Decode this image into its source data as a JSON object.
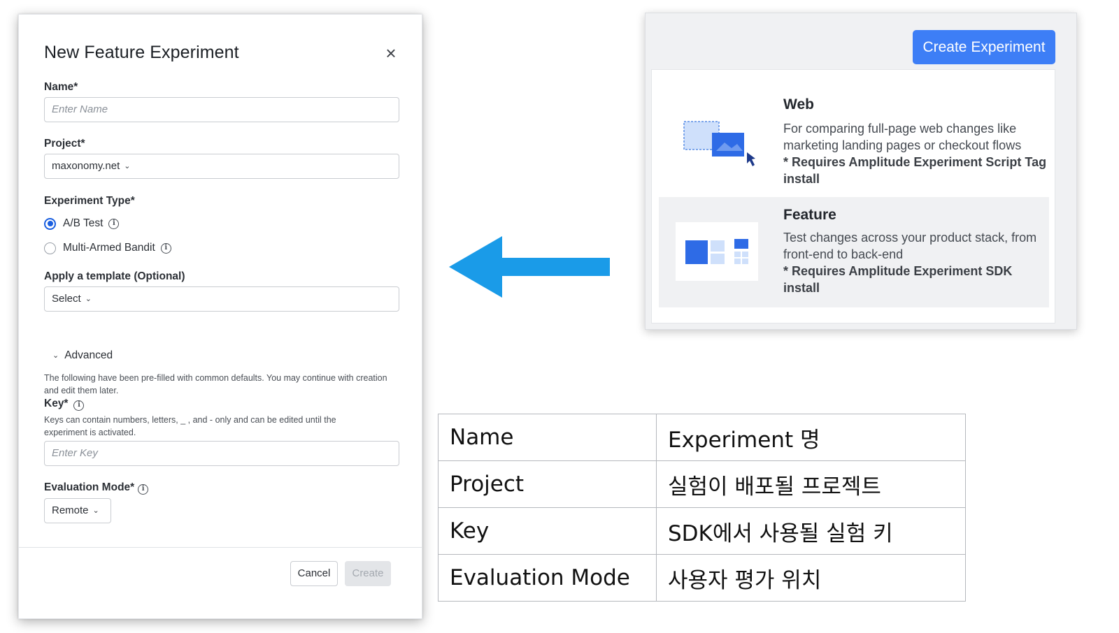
{
  "modal": {
    "title": "New Feature Experiment",
    "close_glyph": "×",
    "name_label": "Name*",
    "name_placeholder": "Enter Name",
    "project_label": "Project*",
    "project_value": "maxonomy.net",
    "experiment_type_label": "Experiment Type*",
    "radio_options": [
      {
        "label": "A/B Test",
        "selected": true
      },
      {
        "label": "Multi-Armed Bandit",
        "selected": false
      }
    ],
    "template_label": "Apply a template (Optional)",
    "template_value": "Select",
    "advanced_label": "Advanced",
    "advanced_help": "The following have been pre-filled with common defaults. You may continue with creation and edit them later.",
    "key_label": "Key*",
    "key_help": "Keys can contain numbers, letters, _ , and - only and can be edited until the experiment is activated.",
    "key_placeholder": "Enter Key",
    "eval_label": "Evaluation Mode*",
    "eval_value": "Remote",
    "cancel_label": "Cancel",
    "create_label": "Create"
  },
  "panel": {
    "create_button": "Create Experiment",
    "web": {
      "title": "Web",
      "desc": "For comparing full-page web changes like marketing landing pages or checkout flows",
      "req": "* Requires Amplitude Experiment Script Tag install"
    },
    "feature": {
      "title": "Feature",
      "desc": "Test changes across your product stack, from front-end to back-end",
      "req": "* Requires Amplitude Experiment SDK install"
    }
  },
  "table": [
    {
      "key": "Name",
      "value": "Experiment 명"
    },
    {
      "key": "Project",
      "value": "실험이 배포될 프로젝트"
    },
    {
      "key": "Key",
      "value": "SDK에서 사용될 실험 키"
    },
    {
      "key": "Evaluation Mode",
      "value": "사용자 평가 위치"
    }
  ],
  "colors": {
    "arrow": "#1a9be8",
    "primary_button": "#3d7ef6",
    "radio_selected": "#1a5fe0"
  },
  "icons": {
    "arrow": "left-arrow-icon",
    "close": "close-icon",
    "info": "info-icon",
    "chevron": "chevron-down-icon",
    "web": "web-illustration-icon",
    "feature": "feature-illustration-icon"
  }
}
